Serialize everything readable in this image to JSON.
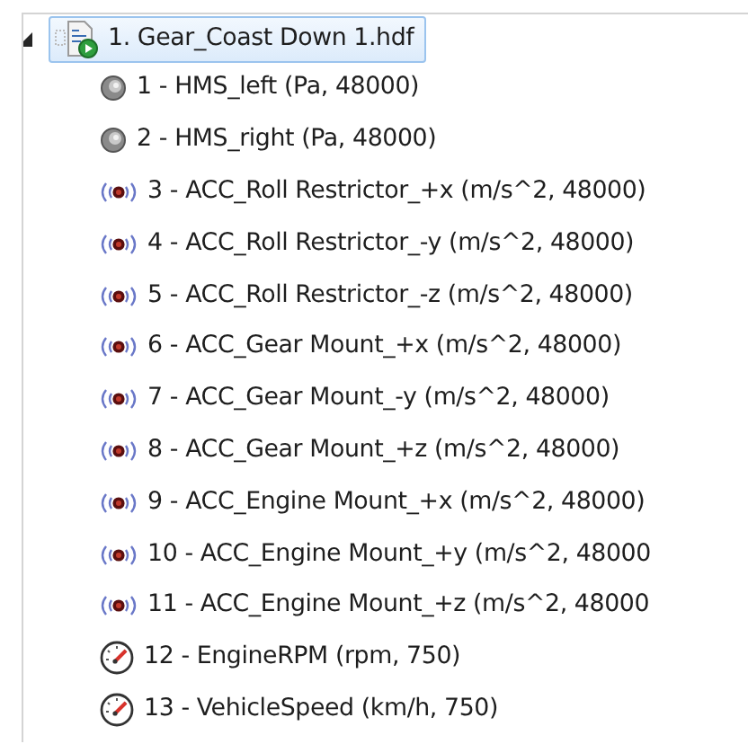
{
  "tree": {
    "label": "1. Gear_Coast Down 1.hdf",
    "expanded": true,
    "selected": true,
    "children": [
      {
        "kind": "mic",
        "label": "1 - HMS_left (Pa, 48000)",
        "selected": false
      },
      {
        "kind": "mic",
        "label": "2 - HMS_right (Pa, 48000)",
        "selected": false
      },
      {
        "kind": "accel",
        "label": "3 - ACC_Roll Restrictor_+x (m/s^2, 48000)",
        "selected": false
      },
      {
        "kind": "accel",
        "label": "4 - ACC_Roll Restrictor_-y (m/s^2, 48000)",
        "selected": false
      },
      {
        "kind": "accel",
        "label": "5 - ACC_Roll Restrictor_-z (m/s^2, 48000)",
        "selected": false
      },
      {
        "kind": "accel",
        "label": "6 - ACC_Gear Mount_+x (m/s^2, 48000)",
        "selected": false
      },
      {
        "kind": "accel",
        "label": "7 - ACC_Gear Mount_-y (m/s^2, 48000)",
        "selected": false
      },
      {
        "kind": "accel",
        "label": "8 - ACC_Gear Mount_+z (m/s^2, 48000)",
        "selected": false
      },
      {
        "kind": "accel",
        "label": "9 - ACC_Engine Mount_+x (m/s^2, 48000)",
        "selected": false
      },
      {
        "kind": "accel",
        "label": "10 - ACC_Engine Mount_+y (m/s^2, 48000",
        "selected": false
      },
      {
        "kind": "accel",
        "label": "11 - ACC_Engine Mount_+z (m/s^2, 48000",
        "selected": false
      },
      {
        "kind": "gauge",
        "label": "12 - EngineRPM (rpm, 750)",
        "selected": false
      },
      {
        "kind": "gauge",
        "label": "13 - VehicleSpeed (km/h, 750)",
        "selected": false
      }
    ]
  }
}
